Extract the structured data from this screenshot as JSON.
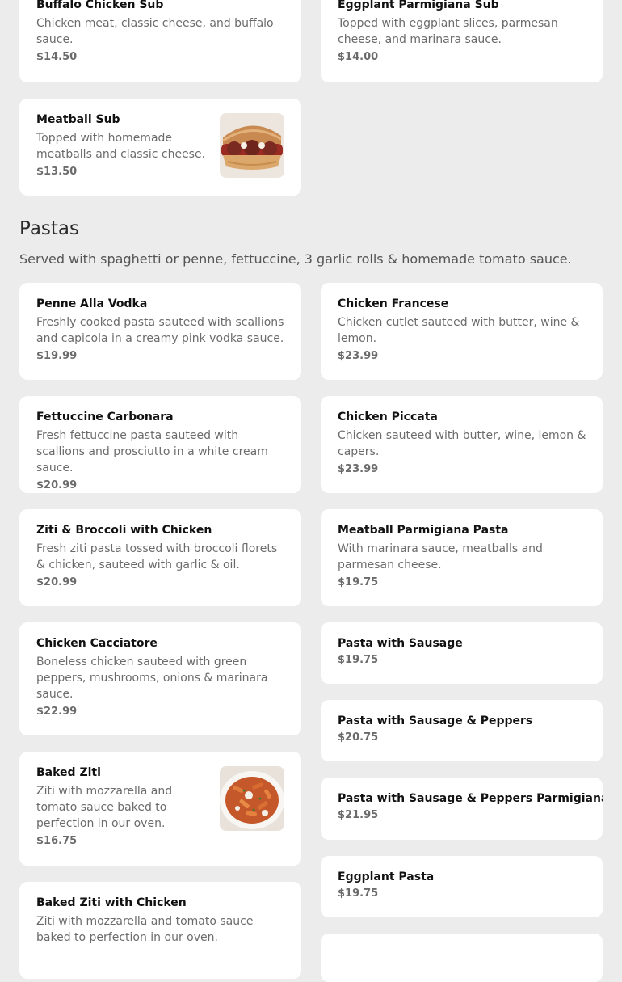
{
  "subs": {
    "items": [
      {
        "name": "Buffalo Chicken Sub",
        "description": "Chicken meat, classic cheese, and buffalo sauce.",
        "price": "$14.50"
      },
      {
        "name": "Eggplant Parmigiana Sub",
        "description": "Topped with eggplant slices, parmesan cheese, and marinara sauce.",
        "price": "$14.00"
      },
      {
        "name": "Meatball Sub",
        "description": "Topped with homemade meatballs and classic cheese.",
        "price": "$13.50",
        "image": "meatball-sub-photo"
      }
    ]
  },
  "pastas": {
    "title": "Pastas",
    "description": "Served with spaghetti or penne, fettuccine, 3 garlic rolls & homemade tomato sauce.",
    "items": [
      {
        "name": "Penne Alla Vodka",
        "description": "Freshly cooked pasta sauteed with scallions and capicola in a creamy pink vodka sauce.",
        "price": "$19.99"
      },
      {
        "name": "Chicken Francese",
        "description": "Chicken cutlet sauteed with butter, wine & lemon.",
        "price": "$23.99"
      },
      {
        "name": "Fettuccine Carbonara",
        "description": "Fresh fettuccine pasta sauteed with scallions and prosciutto in a white cream sauce.",
        "price": "$20.99"
      },
      {
        "name": "Chicken Piccata",
        "description": "Chicken sauteed with butter, wine, lemon & capers.",
        "price": "$23.99"
      },
      {
        "name": "Ziti & Broccoli with Chicken",
        "description": "Fresh ziti pasta tossed with broccoli florets & chicken, sauteed with garlic & oil.",
        "price": "$20.99"
      },
      {
        "name": "Meatball Parmigiana Pasta",
        "description": "With marinara sauce, meatballs and parmesan cheese.",
        "price": "$19.75"
      },
      {
        "name": "Chicken Cacciatore",
        "description": "Boneless chicken sauteed with green peppers, mushrooms, onions & marinara sauce.",
        "price": "$22.99"
      },
      {
        "name": "Pasta with Sausage",
        "price": "$19.75"
      },
      {
        "name": "Pasta with Sausage & Peppers",
        "price": "$20.75"
      },
      {
        "name": "Baked Ziti",
        "description": "Ziti with mozzarella and tomato sauce baked to perfection in our oven.",
        "price": "$16.75",
        "image": "baked-ziti-photo"
      },
      {
        "name": "Pasta with Sausage & Peppers Parmigiana",
        "price": "$21.95"
      },
      {
        "name": "Eggplant Pasta",
        "price": "$19.75"
      },
      {
        "name": "Baked Ziti with Chicken",
        "description": "Ziti with mozzarella and tomato sauce baked to perfection in our oven."
      }
    ]
  },
  "colors": {
    "page_background": "#ececec",
    "card_background": "#ffffff",
    "muted_text": "#6b6b6b"
  }
}
